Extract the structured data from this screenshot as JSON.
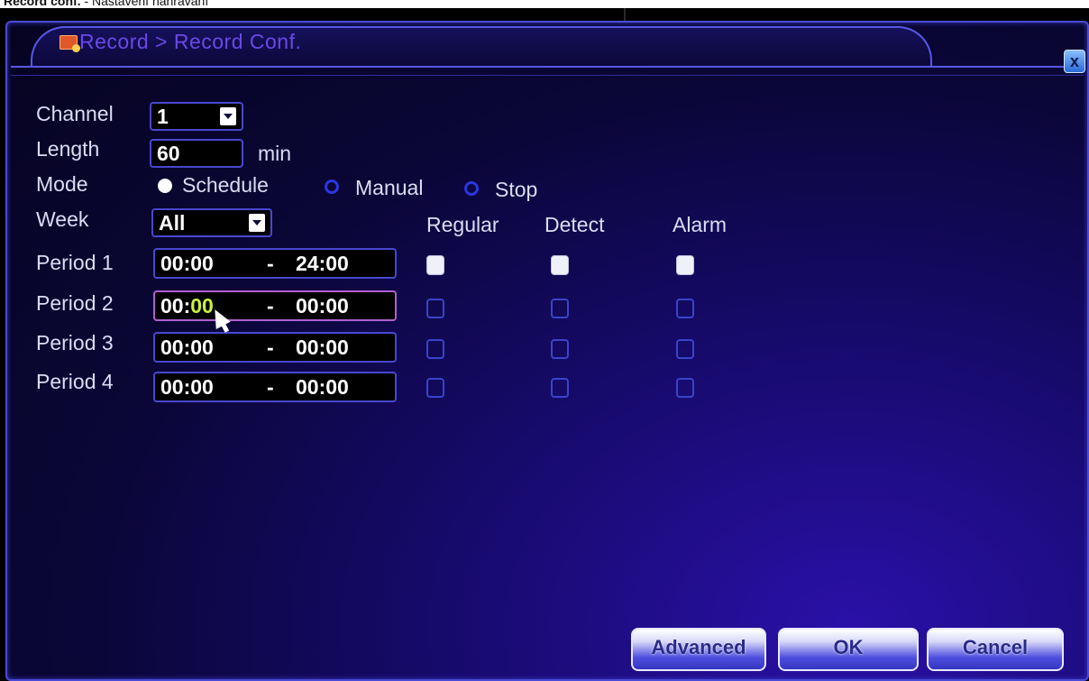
{
  "caption": {
    "bold": "Record conf.",
    "text": " - Nastavení nahrávání"
  },
  "window": {
    "title": "Record > Record Conf.",
    "close_label": "x"
  },
  "form": {
    "channel_label": "Channel",
    "channel_value": "1",
    "length_label": "Length",
    "length_value": "60",
    "length_unit": "min",
    "mode_label": "Mode",
    "mode_options": [
      {
        "label": "Schedule",
        "selected": true
      },
      {
        "label": "Manual",
        "selected": false
      },
      {
        "label": "Stop",
        "selected": false
      }
    ],
    "week_label": "Week",
    "week_value": "All"
  },
  "columns": [
    "Regular",
    "Detect",
    "Alarm"
  ],
  "periods": [
    {
      "label": "Period 1",
      "start_h": "00",
      "start_m": "00",
      "end": "24:00",
      "regular": true,
      "detect": true,
      "alarm": true
    },
    {
      "label": "Period 2",
      "start_h": "00",
      "start_m": "00",
      "end": "00:00",
      "regular": false,
      "detect": false,
      "alarm": false
    },
    {
      "label": "Period 3",
      "start_h": "00",
      "start_m": "00",
      "end": "00:00",
      "regular": false,
      "detect": false,
      "alarm": false
    },
    {
      "label": "Period 4",
      "start_h": "00",
      "start_m": "00",
      "end": "00:00",
      "regular": false,
      "detect": false,
      "alarm": false
    }
  ],
  "buttons": {
    "advanced": "Advanced",
    "ok": "OK",
    "cancel": "Cancel"
  },
  "colors": {
    "window_bg": "#0a0636",
    "accent": "#4848d0",
    "title": "#6a48e8",
    "highlight": "#c8f040"
  }
}
